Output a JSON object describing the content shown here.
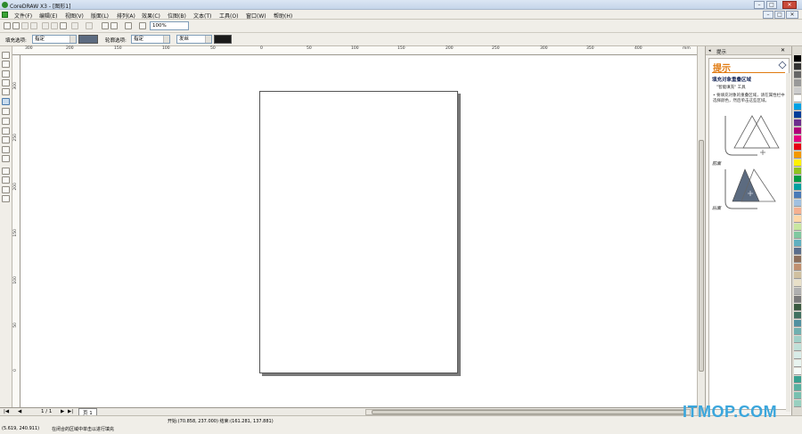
{
  "window": {
    "title": "CoreDRAW X3 - [图形1]",
    "minimize": "–",
    "maximize": "□",
    "close": "✕"
  },
  "menu": [
    "文件(F)",
    "编辑(E)",
    "视图(V)",
    "版面(L)",
    "排列(A)",
    "效果(C)",
    "位图(B)",
    "文本(T)",
    "工具(O)",
    "窗口(W)",
    "帮助(H)"
  ],
  "standard_toolbar": {
    "zoom": "100%"
  },
  "property_bar": {
    "fill_label": "填充选项:",
    "fill_value": "指定",
    "fill_color": "#5c6b80",
    "outline_label": "轮廓选项:",
    "outline_value": "指定",
    "width_value": "发丝",
    "outline_color": "#1a1a1a"
  },
  "ruler": {
    "top_labels": [
      "300",
      "200",
      "150",
      "100",
      "50",
      "0",
      "50",
      "100",
      "150",
      "200",
      "250",
      "300",
      "350",
      "400",
      "mm"
    ],
    "left_labels": [
      "300",
      "250",
      "200",
      "150",
      "100",
      "50",
      "0"
    ]
  },
  "docker": {
    "tab": "提示",
    "title": "提示",
    "heading": "填充对象重叠区域",
    "sub": "\"智能填充\" 工具",
    "body": "• 要填充对象的重叠区域，请在属性栏中选择颜色，然后单击这些区域。",
    "fig1": "前面",
    "fig2": "后面"
  },
  "palette_colors": [
    "#000000",
    "#333333",
    "#666666",
    "#999999",
    "#cccccc",
    "#ffffff",
    "#00a1e4",
    "#003d99",
    "#6d2e8e",
    "#b0007a",
    "#e4007f",
    "#e60012",
    "#f39800",
    "#fff100",
    "#8fc31f",
    "#009944",
    "#00a0a0",
    "#4a7ab7",
    "#a0c0e0",
    "#f5b090",
    "#ffd8a8",
    "#c8e6a0",
    "#80c8a0",
    "#60b0c0",
    "#5a6e8c",
    "#8c6e5a",
    "#c09070",
    "#d0c0a0",
    "#e8e0c8",
    "#b0b0b0",
    "#7a7a7a",
    "#3a5a40",
    "#407060",
    "#5090a0",
    "#70b0b0",
    "#a0d0c8",
    "#c0e0d8",
    "#d8ece8",
    "#e8f4f0",
    "#f4faf8",
    "#38a090",
    "#58b0a0",
    "#78c0b0",
    "#98d0c0"
  ],
  "pagenav": {
    "first": "|◀",
    "prev": "◀",
    "page_count": "1 / 1",
    "next": "▶",
    "last": "▶|",
    "page_tab": "页 1"
  },
  "status": {
    "line1": "开始:(70.858, 237.000) 结束:(161.281, 137.881)",
    "coords": "(5.619, 240.911)",
    "hint": "在闭合的区域中单击以进行填充"
  },
  "watermark": "ITMOP.COM"
}
